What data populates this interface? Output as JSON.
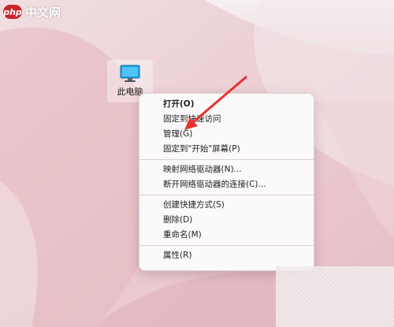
{
  "watermark": {
    "badge": "php",
    "text": "中文网"
  },
  "desktop": {
    "icon_label": "此电脑",
    "icon_semantic": "this-pc-icon"
  },
  "context_menu": {
    "groups": [
      [
        {
          "label": "打开(O)",
          "bold": true
        },
        {
          "label": "固定到快速访问"
        },
        {
          "label": "管理(G)"
        },
        {
          "label": "固定到\"开始\"屏幕(P)"
        }
      ],
      [
        {
          "label": "映射网络驱动器(N)..."
        },
        {
          "label": "断开网络驱动器的连接(C)..."
        }
      ],
      [
        {
          "label": "创建快捷方式(S)"
        },
        {
          "label": "删除(D)"
        },
        {
          "label": "重命名(M)"
        }
      ],
      [
        {
          "label": "属性(R)"
        }
      ]
    ]
  },
  "annotation": {
    "arrow_color": "#e5322d",
    "points_to": "管理(G)"
  },
  "colors": {
    "wallpaper_base": "#e9c9cf",
    "wallpaper_light": "#f6eef0",
    "menu_bg": "#fbf9f9",
    "arrow": "#e5322d"
  }
}
